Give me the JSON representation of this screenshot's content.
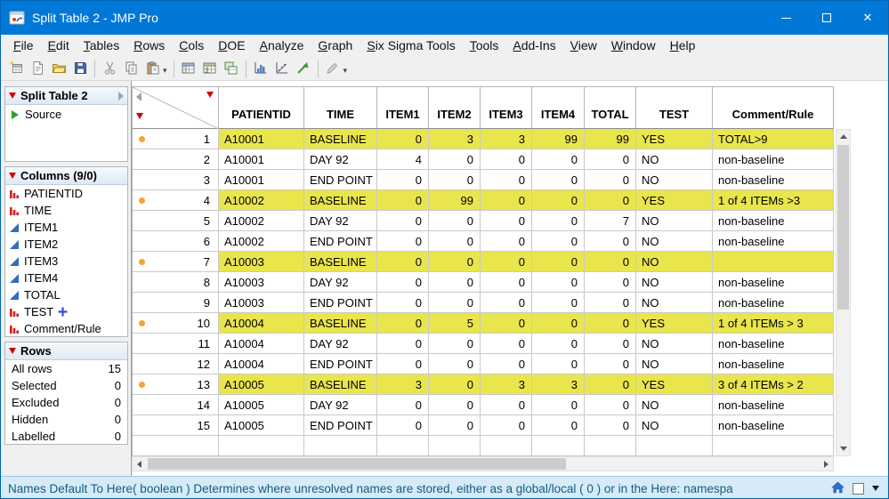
{
  "window": {
    "title": "Split Table 2 - JMP Pro",
    "controls": [
      "minimize",
      "maximize",
      "close"
    ]
  },
  "menu": {
    "items": [
      {
        "label": "File",
        "u": 0
      },
      {
        "label": "Edit",
        "u": 0
      },
      {
        "label": "Tables",
        "u": 0
      },
      {
        "label": "Rows",
        "u": 0
      },
      {
        "label": "Cols",
        "u": 0
      },
      {
        "label": "DOE",
        "u": 0
      },
      {
        "label": "Analyze",
        "u": 0
      },
      {
        "label": "Graph",
        "u": 0
      },
      {
        "label": "Six Sigma Tools",
        "u": 0
      },
      {
        "label": "Tools",
        "u": 0
      },
      {
        "label": "Add-Ins",
        "u": 0
      },
      {
        "label": "View",
        "u": 0
      },
      {
        "label": "Window",
        "u": 0
      },
      {
        "label": "Help",
        "u": 0
      }
    ]
  },
  "toolbar": {
    "items": [
      {
        "t": "btn",
        "name": "new-data-table-button",
        "icon": "new-data-table-icon"
      },
      {
        "t": "btn",
        "name": "new-journal-button",
        "icon": "journal-icon"
      },
      {
        "t": "btn",
        "name": "open-button",
        "icon": "open-folder-icon"
      },
      {
        "t": "btn",
        "name": "save-button",
        "icon": "save-icon"
      },
      {
        "t": "sep"
      },
      {
        "t": "btn",
        "name": "cut-button",
        "icon": "scissors-icon",
        "disabled": true
      },
      {
        "t": "btn",
        "name": "copy-button",
        "icon": "copy-icon"
      },
      {
        "t": "btn",
        "name": "paste-button",
        "icon": "paste-icon"
      },
      {
        "t": "chev"
      },
      {
        "t": "sep"
      },
      {
        "t": "btn",
        "name": "data-table-button",
        "icon": "data-table-icon"
      },
      {
        "t": "btn",
        "name": "summary-button",
        "icon": "summary-table-icon"
      },
      {
        "t": "btn",
        "name": "join-tables-button",
        "icon": "join-tables-icon"
      },
      {
        "t": "sep"
      },
      {
        "t": "btn",
        "name": "distribution-button",
        "icon": "distribution-icon"
      },
      {
        "t": "btn",
        "name": "fit-y-by-x-button",
        "icon": "fit-y-by-x-icon"
      },
      {
        "t": "btn",
        "name": "graph-builder-button",
        "icon": "diagonal-arrow-icon"
      },
      {
        "t": "sep"
      },
      {
        "t": "btn",
        "name": "annotate-button",
        "icon": "pencil-icon",
        "disabled": true
      },
      {
        "t": "chev"
      }
    ]
  },
  "sidebar": {
    "table_panel": {
      "title": "Split Table 2",
      "source_label": "Source"
    },
    "columns_panel": {
      "title": "Columns (9/0)",
      "items": [
        {
          "label": "PATIENTID",
          "type": "nominal"
        },
        {
          "label": "TIME",
          "type": "nominal"
        },
        {
          "label": "ITEM1",
          "type": "continuous"
        },
        {
          "label": "ITEM2",
          "type": "continuous"
        },
        {
          "label": "ITEM3",
          "type": "continuous"
        },
        {
          "label": "ITEM4",
          "type": "continuous"
        },
        {
          "label": "TOTAL",
          "type": "continuous"
        },
        {
          "label": "TEST",
          "type": "nominal",
          "formula": true
        },
        {
          "label": "Comment/Rule",
          "type": "nominal"
        }
      ]
    },
    "rows_panel": {
      "title": "Rows",
      "stats": [
        {
          "label": "All rows",
          "value": "15"
        },
        {
          "label": "Selected",
          "value": "0"
        },
        {
          "label": "Excluded",
          "value": "0"
        },
        {
          "label": "Hidden",
          "value": "0"
        },
        {
          "label": "Labelled",
          "value": "0"
        }
      ]
    }
  },
  "table": {
    "columns": [
      "PATIENTID",
      "TIME",
      "ITEM1",
      "ITEM2",
      "ITEM3",
      "ITEM4",
      "TOTAL",
      "TEST",
      "Comment/Rule"
    ],
    "rows": [
      {
        "n": "1",
        "hl": true,
        "cells": [
          "A10001",
          "BASELINE",
          "0",
          "3",
          "3",
          "99",
          "99",
          "YES",
          "TOTAL>9"
        ]
      },
      {
        "n": "2",
        "hl": false,
        "cells": [
          "A10001",
          "DAY 92",
          "4",
          "0",
          "0",
          "0",
          "0",
          "NO",
          "non-baseline"
        ]
      },
      {
        "n": "3",
        "hl": false,
        "cells": [
          "A10001",
          "END POINT",
          "0",
          "0",
          "0",
          "0",
          "0",
          "NO",
          "non-baseline"
        ]
      },
      {
        "n": "4",
        "hl": true,
        "cells": [
          "A10002",
          "BASELINE",
          "0",
          "99",
          "0",
          "0",
          "0",
          "YES",
          "1 of 4 ITEMs >3"
        ]
      },
      {
        "n": "5",
        "hl": false,
        "cells": [
          "A10002",
          "DAY 92",
          "0",
          "0",
          "0",
          "0",
          "7",
          "NO",
          "non-baseline"
        ]
      },
      {
        "n": "6",
        "hl": false,
        "cells": [
          "A10002",
          "END POINT",
          "0",
          "0",
          "0",
          "0",
          "0",
          "NO",
          "non-baseline"
        ]
      },
      {
        "n": "7",
        "hl": true,
        "cells": [
          "A10003",
          "BASELINE",
          "0",
          "0",
          "0",
          "0",
          "0",
          "NO",
          ""
        ]
      },
      {
        "n": "8",
        "hl": false,
        "cells": [
          "A10003",
          "DAY 92",
          "0",
          "0",
          "0",
          "0",
          "0",
          "NO",
          "non-baseline"
        ]
      },
      {
        "n": "9",
        "hl": false,
        "cells": [
          "A10003",
          "END POINT",
          "0",
          "0",
          "0",
          "0",
          "0",
          "NO",
          "non-baseline"
        ]
      },
      {
        "n": "10",
        "hl": true,
        "cells": [
          "A10004",
          "BASELINE",
          "0",
          "5",
          "0",
          "0",
          "0",
          "YES",
          "1 of 4 ITEMs > 3"
        ]
      },
      {
        "n": "11",
        "hl": false,
        "cells": [
          "A10004",
          "DAY 92",
          "0",
          "0",
          "0",
          "0",
          "0",
          "NO",
          "non-baseline"
        ]
      },
      {
        "n": "12",
        "hl": false,
        "cells": [
          "A10004",
          "END POINT",
          "0",
          "0",
          "0",
          "0",
          "0",
          "NO",
          "non-baseline"
        ]
      },
      {
        "n": "13",
        "hl": true,
        "cells": [
          "A10005",
          "BASELINE",
          "3",
          "0",
          "3",
          "3",
          "0",
          "YES",
          "3 of 4 ITEMs > 2"
        ]
      },
      {
        "n": "14",
        "hl": false,
        "cells": [
          "A10005",
          "DAY 92",
          "0",
          "0",
          "0",
          "0",
          "0",
          "NO",
          "non-baseline"
        ]
      },
      {
        "n": "15",
        "hl": false,
        "cells": [
          "A10005",
          "END POINT",
          "0",
          "0",
          "0",
          "0",
          "0",
          "NO",
          "non-baseline"
        ]
      }
    ]
  },
  "statusbar": {
    "text": "Names Default To Here( boolean )  Determines where unresolved names are stored, either as a global/local ( 0 ) or in the Here: namespa",
    "icons": [
      "home-icon",
      "window-box-icon",
      "dropdown-arrow-icon"
    ]
  },
  "colors": {
    "titlebar": "#0078d7",
    "row_highlight": "#e9e54d",
    "row_marker": "#f2a33a",
    "red_triangle": "#d40000",
    "status_bg": "#d6eaf8"
  }
}
